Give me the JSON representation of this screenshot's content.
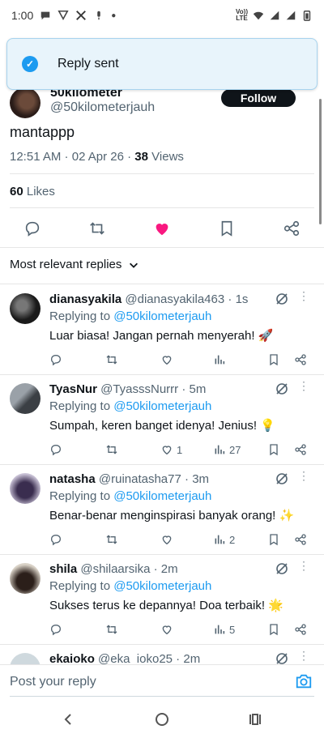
{
  "status_bar": {
    "time": "1:00",
    "lte_line1": "Vo))",
    "lte_line2": "LTE"
  },
  "toast": {
    "text": "Reply sent"
  },
  "tweet": {
    "author_name": "50kilometer",
    "author_handle": "@50kilometerjauh",
    "follow_label": "Follow",
    "text": "mantappp",
    "time": "12:51 AM",
    "date": "02 Apr 26",
    "views_count": "38",
    "views_label": "Views",
    "likes_count": "60",
    "likes_label": "Likes"
  },
  "sort": {
    "label": "Most relevant replies"
  },
  "replies": [
    {
      "name": "dianasyakila",
      "handle": "@dianasyakila463",
      "time": "1s",
      "replying_prefix": "Replying to",
      "replying_to": "@50kilometerjauh",
      "text": "Luar biasa! Jangan pernah menyerah! 🚀",
      "like_count": "",
      "views": ""
    },
    {
      "name": "TyasNur",
      "handle": "@TyasssNurrr",
      "time": "5m",
      "replying_prefix": "Replying to",
      "replying_to": "@50kilometerjauh",
      "text": "Sumpah, keren banget idenya! Jenius! 💡",
      "like_count": "1",
      "views": "27"
    },
    {
      "name": "natasha",
      "handle": "@ruinatasha77",
      "time": "3m",
      "replying_prefix": "Replying to",
      "replying_to": "@50kilometerjauh",
      "text": "Benar-benar menginspirasi banyak orang! ✨",
      "like_count": "",
      "views": "2"
    },
    {
      "name": "shila",
      "handle": "@shilaarsika",
      "time": "2m",
      "replying_prefix": "Replying to",
      "replying_to": "@50kilometerjauh",
      "text": "Sukses terus ke depannya! Doa terbaik! 🌟",
      "like_count": "",
      "views": "5"
    },
    {
      "name": "ekaioko",
      "handle": "@eka_ioko25",
      "time": "2m",
      "replying_prefix": "",
      "replying_to": "",
      "text": "",
      "like_count": "",
      "views": ""
    }
  ],
  "compose": {
    "placeholder": "Post your reply"
  },
  "colors": {
    "accent": "#1d9bf0",
    "like": "#f91880",
    "text": "#0f1419",
    "muted": "#536471"
  },
  "icons": [
    "chat-bubble-icon",
    "whatsapp-icon",
    "pin-icon",
    "x-logo-icon",
    "mic-icon",
    "wifi-icon",
    "signal-icon",
    "battery-icon",
    "check-icon",
    "reply-icon",
    "retweet-icon",
    "heart-icon",
    "bookmark-icon",
    "share-icon",
    "views-icon",
    "grok-icon",
    "more-icon",
    "camera-icon",
    "back-icon",
    "home-icon",
    "recents-icon",
    "chevron-down-icon"
  ]
}
